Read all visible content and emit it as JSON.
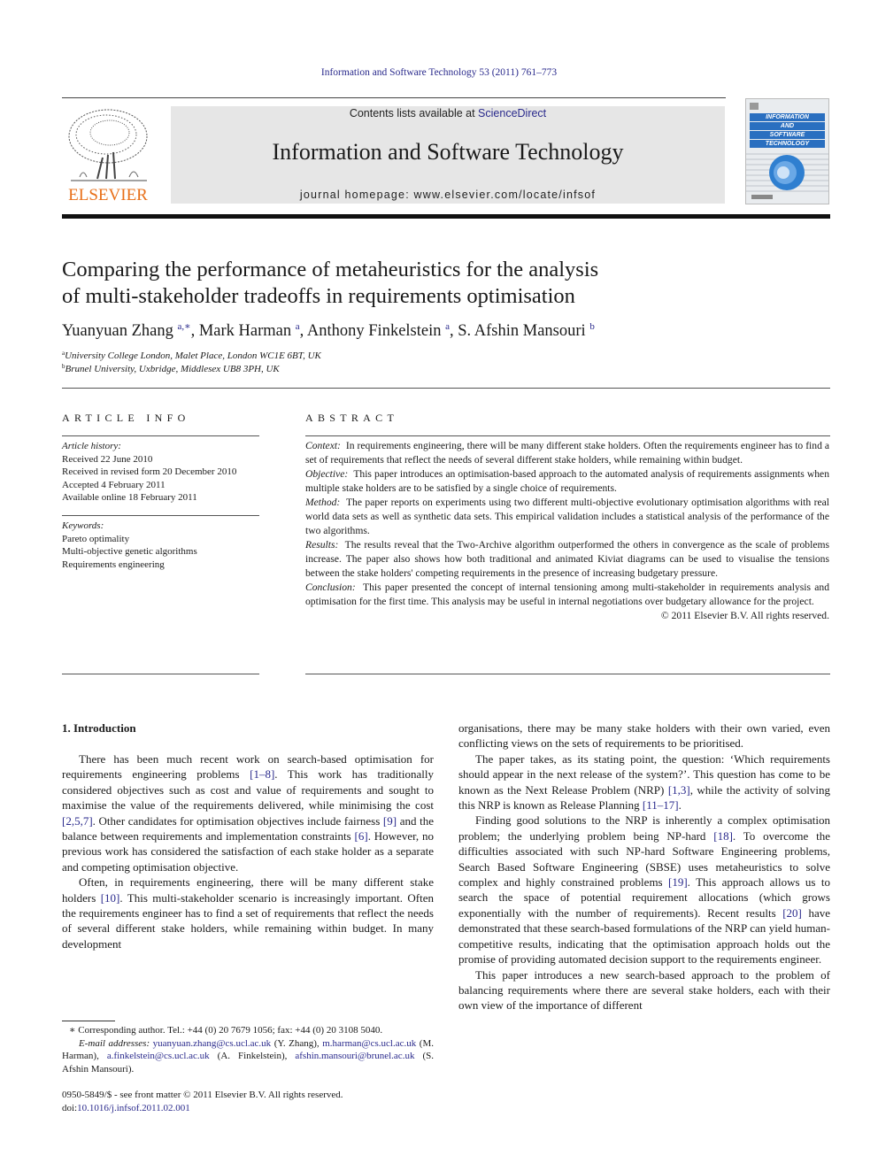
{
  "header": {
    "journal_ref": "Information and Software Technology 53 (2011) 761–773",
    "publisher_logo": "ELSEVIER",
    "contents_prefix": "Contents lists available at ",
    "contents_link": "ScienceDirect",
    "journal_title": "Information and Software Technology",
    "homepage": "journal homepage: www.elsevier.com/locate/infsof",
    "cover_lines": [
      "INFORMATION",
      "AND",
      "SOFTWARE",
      "TECHNOLOGY"
    ]
  },
  "article": {
    "title_line1": "Comparing the performance of metaheuristics for the analysis",
    "title_line2": "of multi-stakeholder tradeoffs in requirements optimisation",
    "authors": [
      {
        "name": "Yuanyuan Zhang",
        "sup": "a,∗"
      },
      {
        "name": "Mark Harman",
        "sup": "a"
      },
      {
        "name": "Anthony Finkelstein",
        "sup": "a"
      },
      {
        "name": "S. Afshin Mansouri",
        "sup": "b"
      }
    ],
    "affiliations": [
      {
        "mark": "a",
        "text": "University College London, Malet Place, London WC1E 6BT, UK"
      },
      {
        "mark": "b",
        "text": "Brunel University, Uxbridge, Middlesex UB8 3PH, UK"
      }
    ]
  },
  "article_info": {
    "heading": "ARTICLE INFO",
    "history_label": "Article history:",
    "history": [
      "Received 22 June 2010",
      "Received in revised form 20 December 2010",
      "Accepted 4 February 2011",
      "Available online 18 February 2011"
    ],
    "keywords_label": "Keywords:",
    "keywords": [
      "Pareto optimality",
      "Multi-objective genetic algorithms",
      "Requirements engineering"
    ]
  },
  "abstract": {
    "heading": "ABSTRACT",
    "sections": [
      {
        "label": "Context:",
        "text": "In requirements engineering, there will be many different stake holders. Often the requirements engineer has to find a set of requirements that reflect the needs of several different stake holders, while remaining within budget."
      },
      {
        "label": "Objective:",
        "text": "This paper introduces an optimisation-based approach to the automated analysis of requirements assignments when multiple stake holders are to be satisfied by a single choice of requirements."
      },
      {
        "label": "Method:",
        "text": "The paper reports on experiments using two different multi-objective evolutionary optimisation algorithms with real world data sets as well as synthetic data sets. This empirical validation includes a statistical analysis of the performance of the two algorithms."
      },
      {
        "label": "Results:",
        "text": "The results reveal that the Two-Archive algorithm outperformed the others in convergence as the scale of problems increase. The paper also shows how both traditional and animated Kiviat diagrams can be used to visualise the tensions between the stake holders' competing requirements in the presence of increasing budgetary pressure."
      },
      {
        "label": "Conclusion:",
        "text": "This paper presented the concept of internal tensioning among multi-stakeholder in requirements analysis and optimisation for the first time. This analysis may be useful in internal negotiations over budgetary allowance for the project."
      }
    ],
    "copyright": "© 2011 Elsevier B.V. All rights reserved."
  },
  "body": {
    "intro_heading": "1. Introduction",
    "left_col": {
      "p1": [
        {
          "t": "There has been much recent work on search-based optimisation for requirements engineering problems "
        },
        {
          "ref": "[1–8]"
        },
        {
          "t": ". This work has traditionally considered objectives such as cost and value of requirements and sought to maximise the value of the requirements delivered, while minimising the cost "
        },
        {
          "ref": "[2,5,7]"
        },
        {
          "t": ". Other candidates for optimisation objectives include fairness "
        },
        {
          "ref": "[9]"
        },
        {
          "t": " and the balance between requirements and implementation constraints "
        },
        {
          "ref": "[6]"
        },
        {
          "t": ". However, no previous work has considered the satisfaction of each stake holder as a separate and competing optimisation objective."
        }
      ],
      "p2": [
        {
          "t": "Often, in requirements engineering, there will be many different stake holders "
        },
        {
          "ref": "[10]"
        },
        {
          "t": ". This multi-stakeholder scenario is increasingly important. Often the requirements engineer has to find a set of requirements that reflect the needs of several different stake holders, while remaining within budget. In many development"
        }
      ]
    },
    "right_col": {
      "p0": [
        {
          "t": "organisations, there may be many stake holders with their own varied, even conflicting views on the sets of requirements to be prioritised."
        }
      ],
      "p1": [
        {
          "t": "The paper takes, as its stating point, the question: ‘Which requirements should appear in the next release of the system?’. This question has come to be known as the Next Release Problem (NRP) "
        },
        {
          "ref": "[1,3]"
        },
        {
          "t": ", while the activity of solving this NRP is known as Release Planning "
        },
        {
          "ref": "[11–17]"
        },
        {
          "t": "."
        }
      ],
      "p2": [
        {
          "t": "Finding good solutions to the NRP is inherently a complex optimisation problem; the underlying problem being NP-hard "
        },
        {
          "ref": "[18]"
        },
        {
          "t": ". To overcome the difficulties associated with such NP-hard Software Engineering problems, Search Based Software Engineering (SBSE) uses metaheuristics to solve complex and highly constrained problems "
        },
        {
          "ref": "[19]"
        },
        {
          "t": ". This approach allows us to search the space of potential requirement allocations (which grows exponentially with the number of requirements). Recent results "
        },
        {
          "ref": "[20]"
        },
        {
          "t": " have demonstrated that these search-based formulations of the NRP can yield human-competitive results, indicating that the optimisation approach holds out the promise of providing automated decision support to the requirements engineer."
        }
      ],
      "p3": [
        {
          "t": "This paper introduces a new search-based approach to the problem of balancing requirements where there are several stake holders, each with their own view of the importance of different"
        }
      ]
    }
  },
  "footnotes": {
    "corresponding": "∗  Corresponding author. Tel.: +44 (0) 20 7679 1056; fax: +44 (0) 20 3108 5040.",
    "email_label": "E-mail addresses:",
    "emails": [
      {
        "addr": "yuanyuan.zhang@cs.ucl.ac.uk",
        "who": " (Y. Zhang), "
      },
      {
        "addr": "m.harman@cs.ucl.ac.uk",
        "who": " (M. Harman), "
      },
      {
        "addr": "a.finkelstein@cs.ucl.ac.uk",
        "who": " (A. Finkelstein), "
      },
      {
        "addr": "afshin.mansouri@brunel.ac.uk",
        "who": " (S. Afshin Mansouri)."
      }
    ],
    "issn": "0950-5849/$ - see front matter © 2011 Elsevier B.V. All rights reserved.",
    "doi_label": "doi:",
    "doi": "10.1016/j.infsof.2011.02.001"
  },
  "colors": {
    "link": "#2a2a8c",
    "elsevier_orange": "#e8701a",
    "masthead_bg": "#e6e6e6",
    "cover_blue": "#2a6fc0"
  }
}
